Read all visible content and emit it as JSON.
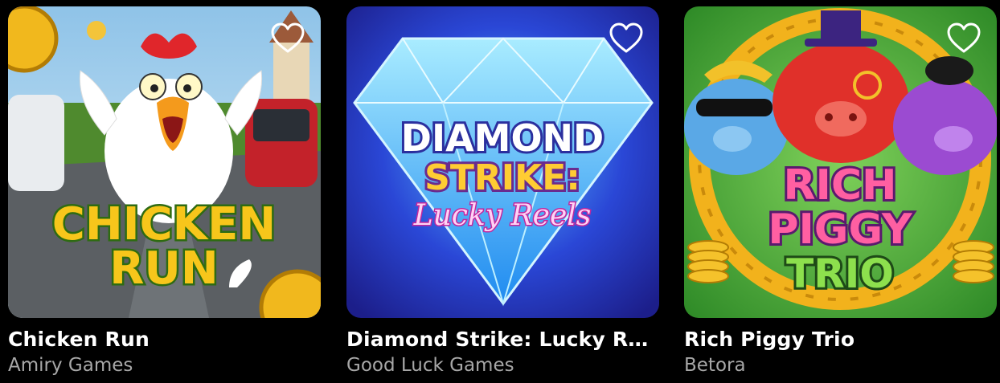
{
  "games": [
    {
      "title": "Chicken Run",
      "provider": "Amiry Games",
      "logo_lines": [
        "CHICKEN",
        "RUN"
      ],
      "colors": {
        "sky": "#8fc3e8",
        "road": "#5b5f63",
        "logo": "#f7c61b",
        "logo_stroke": "#2e6b12"
      }
    },
    {
      "title": "Diamond Strike: Lucky R…",
      "provider": "Good Luck Games",
      "logo_lines": [
        "DIAMOND",
        "STRIKE:",
        "Lucky Reels"
      ],
      "colors": {
        "bg": "#1d2fc4",
        "gem": "#3fd0ff",
        "logo": "#ffffff",
        "accent": "#ffcc33",
        "pink": "#ff7bdc"
      }
    },
    {
      "title": "Rich Piggy Trio",
      "provider": "Betora",
      "logo_lines": [
        "RICH",
        "PIGGY",
        "TRIO"
      ],
      "colors": {
        "bg": "#4aa83a",
        "ring": "#f2b21c",
        "pig_red": "#e0302a",
        "pig_blue": "#5aa8e6",
        "pig_purple": "#9b4bd1",
        "logo": "#ff5fa2"
      }
    }
  ],
  "icons": {
    "favorite": "heart-outline-icon"
  }
}
